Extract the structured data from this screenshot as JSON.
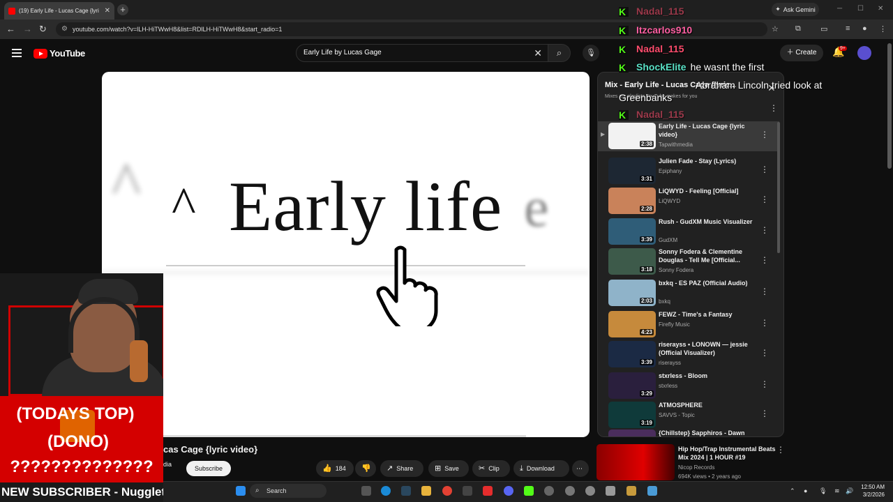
{
  "browser": {
    "tab_title": "(19) Early Life - Lucas Cage {lyri",
    "tab_close": "✕",
    "new_tab": "+",
    "ask_gemini": "Ask Gemini",
    "url": "youtube.com/watch?v=lLH-HiTWwH8&list=RDlLH-HiTWwH8&start_radio=1"
  },
  "youtube": {
    "logo_text": "YouTube",
    "search_value": "Early Life by Lucas Gage",
    "create_label": "Create",
    "notifications_badge": "9+"
  },
  "video": {
    "overlay_caret": "^",
    "overlay_text": "Early life",
    "ghost_left": "^",
    "ghost_right": "e",
    "title": "cas Cage {lyric video}",
    "channel_fragment": "dia",
    "subscribe_label": "Subscribe",
    "like_count": "184",
    "share_label": "Share",
    "save_label": "Save",
    "clip_label": "Clip",
    "download_label": "Download"
  },
  "playlist": {
    "header": "Mix - Early Life - Lucas Cage {lyric...",
    "subheader": "Mixes are playlists YouTube makes for you",
    "items": [
      {
        "title": "Early Life - Lucas Cage {lyric video}",
        "channel": "Tapwithmedia",
        "duration": "2:38",
        "thumb_color": "#f2f2f2"
      },
      {
        "title": "Julien Fade - Stay (Lyrics)",
        "channel": "Epiphany",
        "duration": "3:31",
        "thumb_color": "#1d2733"
      },
      {
        "title": "LiQWYD - Feeling [Official]",
        "channel": "LiQWYD",
        "duration": "2:28",
        "thumb_color": "#c9825a"
      },
      {
        "title": "Rush - GudXM Music Visualizer",
        "channel": "GudXM",
        "duration": "3:39",
        "thumb_color": "#2f5d78"
      },
      {
        "title": "Sonny Fodera & Clementine Douglas - Tell Me [Official...",
        "channel": "Sonny Fodera",
        "duration": "3:18",
        "thumb_color": "#3d5a4a"
      },
      {
        "title": "bxkq - ES PAZ (Official Audio)",
        "channel": "bxkq",
        "duration": "2:03",
        "thumb_color": "#8fb3c9"
      },
      {
        "title": "FEWZ - Time's a Fantasy",
        "channel": "Firefly Music",
        "duration": "4:23",
        "thumb_color": "#c68a3c"
      },
      {
        "title": "riserayss • LONOWN — jessie (Official Visualizer)",
        "channel": "riserayss",
        "duration": "3:39",
        "thumb_color": "#1b2a44"
      },
      {
        "title": "stxrless - Bloom",
        "channel": "stxrless",
        "duration": "3:29",
        "thumb_color": "#2a1f3d"
      },
      {
        "title": "ATMOSPHERE",
        "channel": "SAVVS - Topic",
        "duration": "3:19",
        "thumb_color": "#0f3a3a"
      },
      {
        "title": "{Chillstep} Sapphiros - Dawn",
        "channel": "",
        "duration": "",
        "thumb_color": "#4a2d5c"
      }
    ]
  },
  "recommendation": {
    "title": "Hip Hop/Trap Instrumental Beats Mix 2024 | 1 HOUR #19",
    "channel": "Nicop Records",
    "meta": "694K views • 2 years ago"
  },
  "chat": {
    "lines": [
      {
        "user": "Nadal_115",
        "msg": "",
        "color": "#ff4d6d"
      },
      {
        "user": "Itzcarlos910",
        "msg": "",
        "color": "#ff5fa2"
      },
      {
        "user": "Nadal_115",
        "msg": "",
        "color": "#ff4d6d"
      },
      {
        "user": "ShockElite",
        "msg": "he wasnt the first",
        "color": "#59e0c5"
      }
    ],
    "multiline": "Abraham Lincoln tried look at Greenbanks",
    "last_user": "Nadal_115"
  },
  "stream_overlay": {
    "banner_line1": "(TODAYS TOP)",
    "banner_line2": "(DONO)",
    "banner_line3": "??????????????",
    "new_subscriber": "NEW SUBSCRIBER - Nugglett"
  },
  "taskbar": {
    "search_label": "Search",
    "time": "12:50 AM",
    "date": "3/2/2026"
  }
}
